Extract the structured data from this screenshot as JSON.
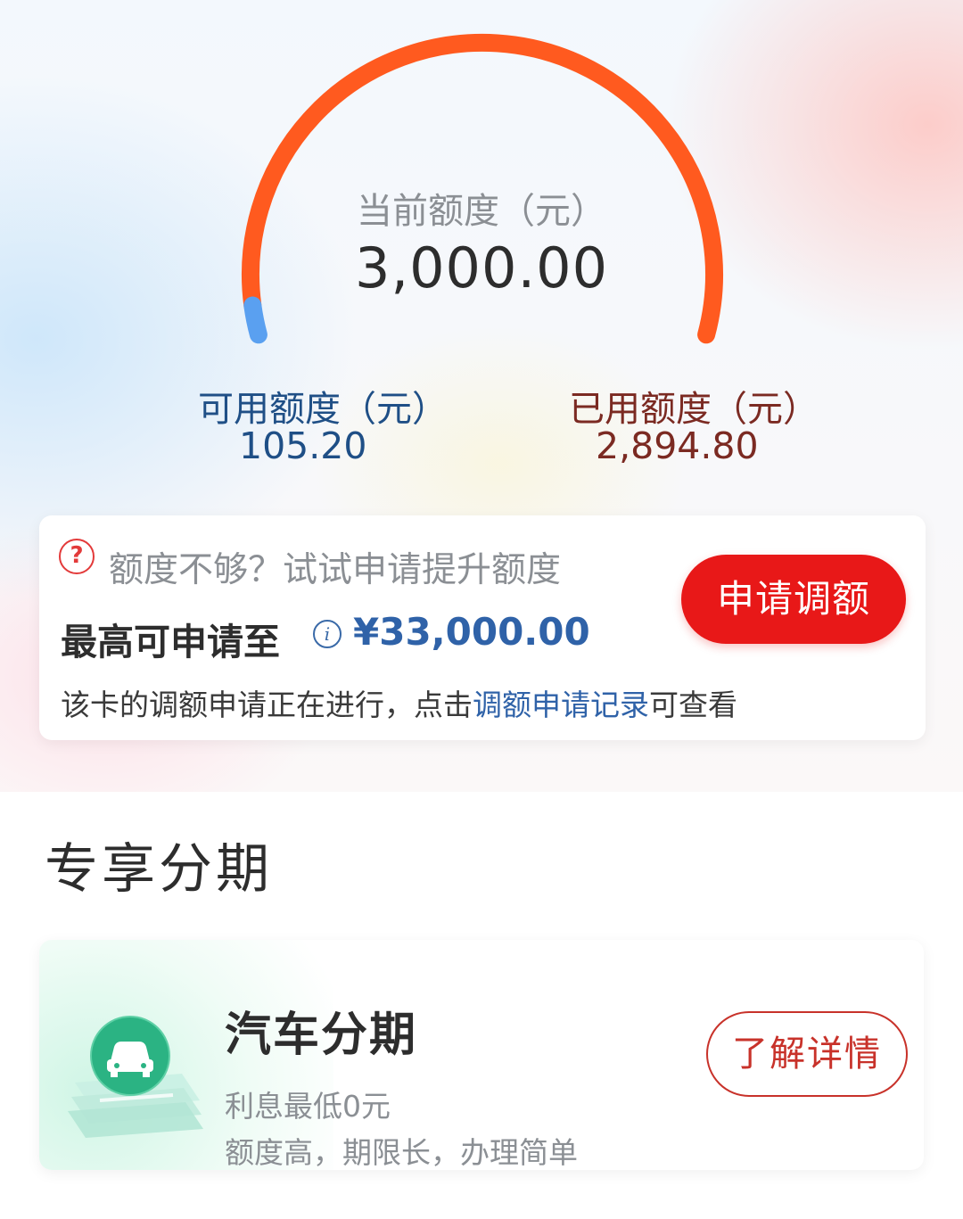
{
  "gauge": {
    "label": "当前额度（元）",
    "value": "3,000.00",
    "available_fraction": 0.0351,
    "colors": {
      "used": "#ff5a1f",
      "available": "#5aa0f0"
    }
  },
  "available": {
    "label": "可用额度（元）",
    "value": "105.20"
  },
  "used": {
    "label": "已用额度（元）",
    "value": "2,894.80"
  },
  "adjust_card": {
    "hint": "额度不够？试试申请提升额度",
    "max_label": "最高可申请至",
    "max_value": "¥33,000.00",
    "note_prefix": "该卡的调额申请正在进行，点击",
    "note_link": "调额申请记录",
    "note_suffix": "可查看",
    "apply_button": "申请调额",
    "icons": {
      "question": "question-icon",
      "info": "info-icon"
    },
    "question_glyph": "?",
    "info_glyph": "i"
  },
  "section": {
    "title": "专享分期"
  },
  "product": {
    "title": "汽车分期",
    "desc1": "利息最低0元",
    "desc2": "额度高，期限长，办理简单",
    "button": "了解详情",
    "icon": "car-icon"
  }
}
